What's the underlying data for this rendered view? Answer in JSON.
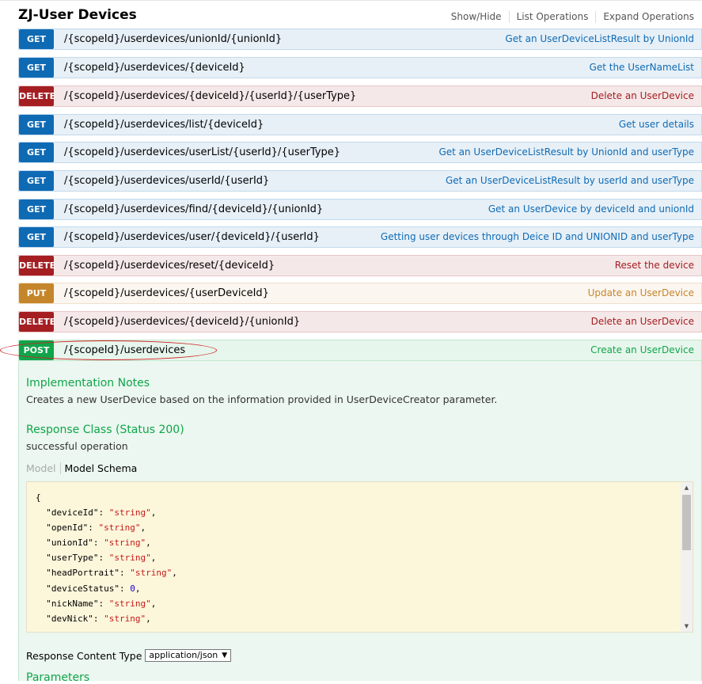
{
  "header": {
    "title": "ZJ-User Devices",
    "links": [
      "Show/Hide",
      "List Operations",
      "Expand Operations"
    ]
  },
  "operations": [
    {
      "method": "GET",
      "path": "/{scopeId}/userdevices/unionId/{unionId}",
      "summary": "Get an UserDeviceListResult by UnionId"
    },
    {
      "method": "GET",
      "path": "/{scopeId}/userdevices/{deviceId}",
      "summary": "Get the UserNameList"
    },
    {
      "method": "DELETE",
      "path": "/{scopeId}/userdevices/{deviceId}/{userId}/{userType}",
      "summary": "Delete an UserDevice"
    },
    {
      "method": "GET",
      "path": "/{scopeId}/userdevices/list/{deviceId}",
      "summary": "Get user details"
    },
    {
      "method": "GET",
      "path": "/{scopeId}/userdevices/userList/{userId}/{userType}",
      "summary": "Get an UserDeviceListResult by UnionId and userType"
    },
    {
      "method": "GET",
      "path": "/{scopeId}/userdevices/userId/{userId}",
      "summary": "Get an UserDeviceListResult by userId and userType"
    },
    {
      "method": "GET",
      "path": "/{scopeId}/userdevices/find/{deviceId}/{unionId}",
      "summary": "Get an UserDevice by deviceId and unionId"
    },
    {
      "method": "GET",
      "path": "/{scopeId}/userdevices/user/{deviceId}/{userId}",
      "summary": "Getting user devices through Deice ID and UNIONID and userType"
    },
    {
      "method": "DELETE",
      "path": "/{scopeId}/userdevices/reset/{deviceId}",
      "summary": "Reset the device"
    },
    {
      "method": "PUT",
      "path": "/{scopeId}/userdevices/{userDeviceId}",
      "summary": "Update an UserDevice"
    },
    {
      "method": "DELETE",
      "path": "/{scopeId}/userdevices/{deviceId}/{unionId}",
      "summary": "Delete an UserDevice"
    },
    {
      "method": "POST",
      "path": "/{scopeId}/userdevices",
      "summary": "Create an UserDevice"
    }
  ],
  "expanded": {
    "impl_heading": "Implementation Notes",
    "impl_text": "Creates a new UserDevice based on the information provided in UserDeviceCreator parameter.",
    "response_heading": "Response Class (Status 200)",
    "response_text": "successful operation",
    "tab_model": "Model",
    "tab_schema": "Model Schema",
    "schema_lines": [
      "{",
      "  \"deviceId\": \"string\",",
      "  \"openId\": \"string\",",
      "  \"unionId\": \"string\",",
      "  \"userType\": \"string\",",
      "  \"headPortrait\": \"string\",",
      "  \"deviceStatus\": 0,",
      "  \"nickName\": \"string\",",
      "  \"devNick\": \"string\","
    ],
    "content_type_label": "Response Content Type",
    "content_type_value": "application/json",
    "parameters_heading": "Parameters"
  },
  "colors": {
    "get": "#0f6ab4",
    "delete": "#a41e22",
    "put": "#c5862b",
    "post": "#10a54a",
    "highlight": "#cc2222"
  },
  "icons": {
    "select_arrow": "caret-down-icon",
    "scroll_up": "scroll-up-arrow-icon",
    "scroll_down": "scroll-down-arrow-icon"
  }
}
